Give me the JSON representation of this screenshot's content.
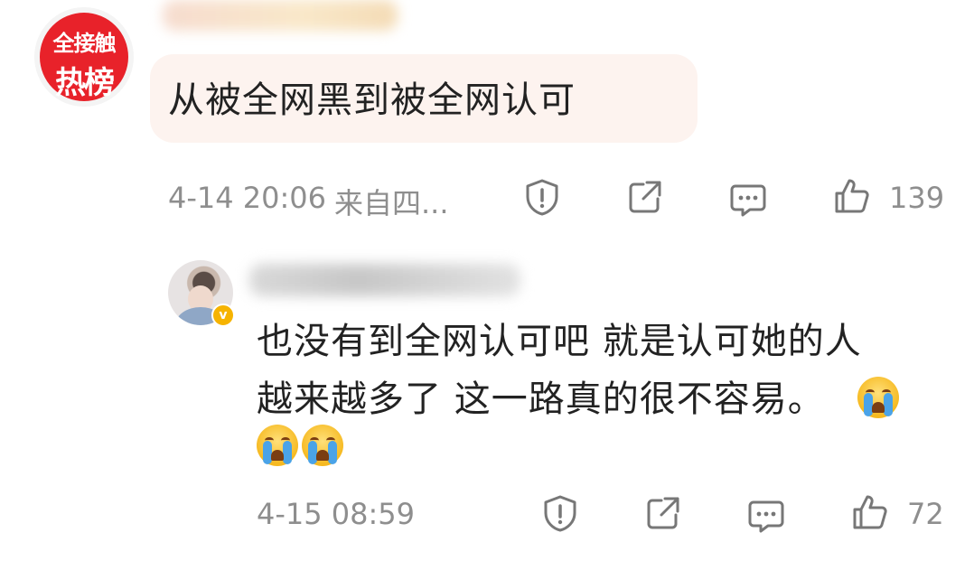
{
  "comment1": {
    "avatar_badge": {
      "line1": "全接触",
      "line2": "热榜"
    },
    "text": "从被全网黑到被全网认可",
    "timestamp": "4-14 20:06",
    "location": "来自四...",
    "likes": "139"
  },
  "comment2": {
    "text_line1": "也没有到全网认可吧 就是认可她的人",
    "text_line2": "越来越多了 这一路真的很不容易。",
    "timestamp": "4-15 08:59",
    "likes": "72"
  },
  "icons": {
    "report": "warning-shield-icon",
    "share": "share-icon",
    "comment": "comment-icon",
    "like": "thumbs-up-icon",
    "emoji": "crying-face-emoji"
  },
  "colors": {
    "badge_red": "#e8222a",
    "bubble_bg": "#fdf3ef",
    "meta_gray": "#8e8e8e",
    "verified_gold": "#f6b300"
  }
}
